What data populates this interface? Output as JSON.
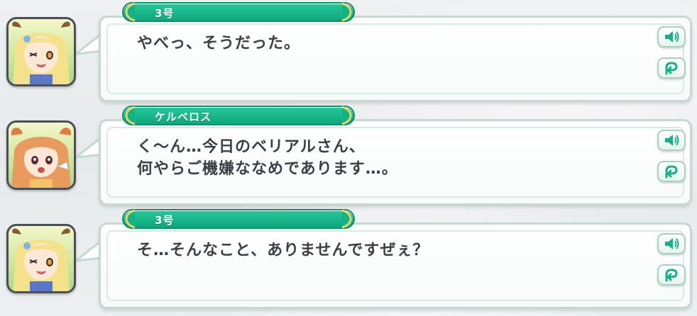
{
  "entries": [
    {
      "speaker": "3号",
      "text": "やべっ、そうだった。",
      "avatar": "3go-portrait",
      "hair_color": "#f7e58a",
      "icons": {
        "voice": "speaker-icon",
        "replay": "replay-arrow-icon"
      }
    },
    {
      "speaker": "ケルベロス",
      "text": "く～ん…今日のベリアルさん、\n何やらご機嫌ななめであります…。",
      "avatar": "cerberus-portrait",
      "hair_color": "#e99a5e",
      "icons": {
        "voice": "speaker-icon",
        "replay": "replay-arrow-icon"
      }
    },
    {
      "speaker": "3号",
      "text": "そ…そんなこと、ありませんですぜぇ？",
      "avatar": "3go-portrait",
      "hair_color": "#f7e58a",
      "icons": {
        "voice": "speaker-icon",
        "replay": "replay-arrow-icon"
      }
    }
  ],
  "colors": {
    "accent_green": "#1bb98c",
    "text": "#3b4048",
    "bubble_border": "#c4d9cf"
  }
}
